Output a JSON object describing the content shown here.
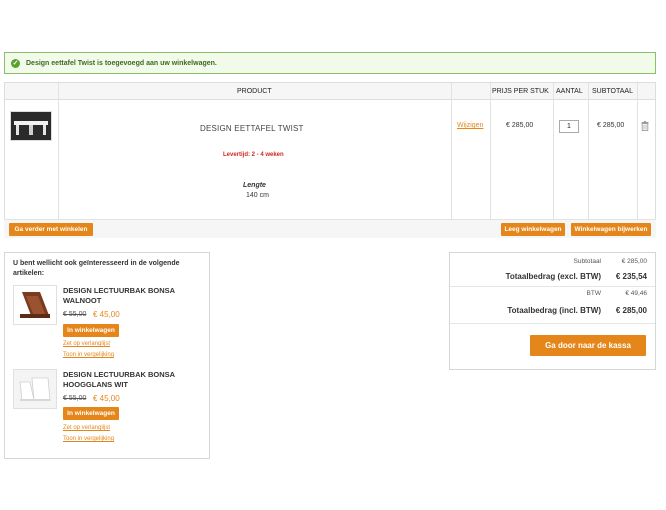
{
  "notice": {
    "message": "Design eettafel Twist is toegevoegd aan uw winkelwagen."
  },
  "cart": {
    "headers": {
      "product": "PRODUCT",
      "price": "PRIJS PER STUK",
      "qty": "AANTAL",
      "subtotal": "SUBTOTAAL"
    },
    "item": {
      "name": "DESIGN EETTAFEL TWIST",
      "delivery": "Levertijd: 2 - 4 weken",
      "option_label": "Lengte",
      "option_value": "140 cm",
      "edit_label": "Wijzigen",
      "price": "€ 285,00",
      "qty": "1",
      "subtotal": "€ 285,00"
    },
    "buttons": {
      "continue": "Ga verder met winkelen",
      "empty": "Leeg winkelwagen",
      "update": "Winkelwagen bijwerken"
    }
  },
  "crosssell": {
    "title": "U bent wellicht ook geïnteresseerd in de volgende artikelen:",
    "items": [
      {
        "name_line1": "DESIGN LECTUURBAK BONSA",
        "name_line2": "WALNOOT",
        "old_price": "€ 55,00",
        "new_price": "€ 45,00",
        "add_label": "In winkelwagen",
        "wishlist_label": "Zet op verlanglijst",
        "compare_label": "Toon in vergelijking"
      },
      {
        "name_line1": "DESIGN LECTUURBAK BONSA",
        "name_line2": "HOOGGLANS WIT",
        "old_price": "€ 55,00",
        "new_price": "€ 45,00",
        "add_label": "In winkelwagen",
        "wishlist_label": "Zet op verlanglijst",
        "compare_label": "Toon in vergelijking"
      }
    ]
  },
  "totals": {
    "subtotal_label": "Subtotaal",
    "subtotal_value": "€ 285,00",
    "excl_label": "Totaalbedrag (excl. BTW)",
    "excl_value": "€ 235,54",
    "tax_label": "BTW",
    "tax_value": "€ 49,46",
    "incl_label": "Totaalbedrag (incl. BTW)",
    "incl_value": "€ 285,00",
    "checkout_label": "Ga door naar de kassa"
  },
  "colors": {
    "accent": "#e5861a",
    "success": "#5aa32b",
    "delivery": "#d0261b"
  }
}
